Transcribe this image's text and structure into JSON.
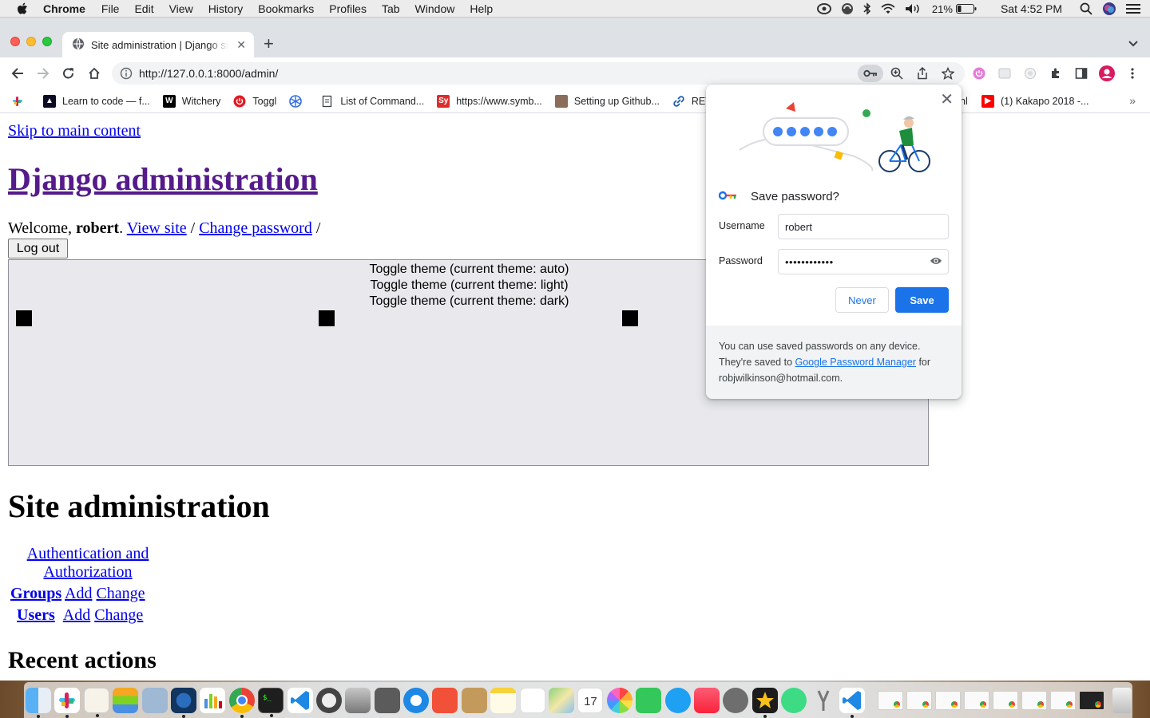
{
  "menubar": {
    "app_name": "Chrome",
    "items": [
      "File",
      "Edit",
      "View",
      "History",
      "Bookmarks",
      "Profiles",
      "Tab",
      "Window",
      "Help"
    ],
    "battery_percent": "21%",
    "clock": "Sat 4:52 PM"
  },
  "tab": {
    "title": "Site administration | Django site admin",
    "close_glyph": "✕",
    "new_tab_glyph": "+"
  },
  "omnibox": {
    "url": "http://127.0.0.1:8000/admin/"
  },
  "bookmarks": {
    "items": [
      {
        "label": "",
        "icon": "slack-icon"
      },
      {
        "label": "Learn to code — f...",
        "icon": "freecodecamp-icon"
      },
      {
        "label": "Witchery",
        "icon": "witchery-icon"
      },
      {
        "label": "Toggl",
        "icon": "toggl-icon"
      },
      {
        "label": "",
        "icon": "kubernetes-icon"
      },
      {
        "label": "List of Command...",
        "icon": "document-icon"
      },
      {
        "label": "https://www.symb...",
        "icon": "symbolab-icon"
      },
      {
        "label": "Setting up Github...",
        "icon": "github-avatar-icon"
      },
      {
        "label": "RET",
        "icon": "link-icon"
      },
      {
        "label": "nl",
        "icon": ""
      },
      {
        "label": "(1) Kakapo 2018 -...",
        "icon": "youtube-icon"
      }
    ],
    "more_glyph": "»"
  },
  "page": {
    "skip_link": "Skip to main content",
    "site_title": "Django administration",
    "welcome_prefix": "Welcome, ",
    "username": "robert",
    "welcome_suffix": ". ",
    "view_site": "View site",
    "separator": " / ",
    "change_password": "Change password",
    "trailing_separator": " /",
    "logout": "Log out",
    "theme_toggles": [
      "Toggle theme (current theme: auto)",
      "Toggle theme (current theme: light)",
      "Toggle theme (current theme: dark)"
    ],
    "section_title": "Site administration",
    "app": {
      "caption": "Authentication and Authorization",
      "models": [
        {
          "name": "Groups",
          "add": "Add",
          "change": "Change"
        },
        {
          "name": "Users",
          "add": "Add",
          "change": "Change"
        }
      ]
    },
    "recent_actions": "Recent actions"
  },
  "password_bubble": {
    "title": "Save password?",
    "username_label": "Username",
    "username_value": "robert",
    "password_label": "Password",
    "password_mask": "••••••••••••",
    "never_label": "Never",
    "save_label": "Save",
    "footer_line1": "You can use saved passwords on any device.",
    "footer_line2_prefix": "They're saved to ",
    "footer_link": "Google Password Manager",
    "footer_line2_suffix": " for",
    "footer_email": "robjwilkinson@hotmail.com.",
    "accent_color": "#1a73e8"
  },
  "dock": {
    "apps": [
      "finder",
      "slack",
      "textedit",
      "stack",
      "preview",
      "quicktime",
      "numbers",
      "chrome",
      "terminal",
      "vscode",
      "tableplus",
      "sequel",
      "calculator",
      "safari",
      "swift",
      "notebook",
      "notes",
      "reminders",
      "maps",
      "calendar",
      "photos",
      "facetime",
      "messages",
      "music",
      "system-preferences",
      "imovie",
      "android-file-transfer",
      "tools",
      "vscode-2"
    ],
    "calendar_day": "17"
  }
}
